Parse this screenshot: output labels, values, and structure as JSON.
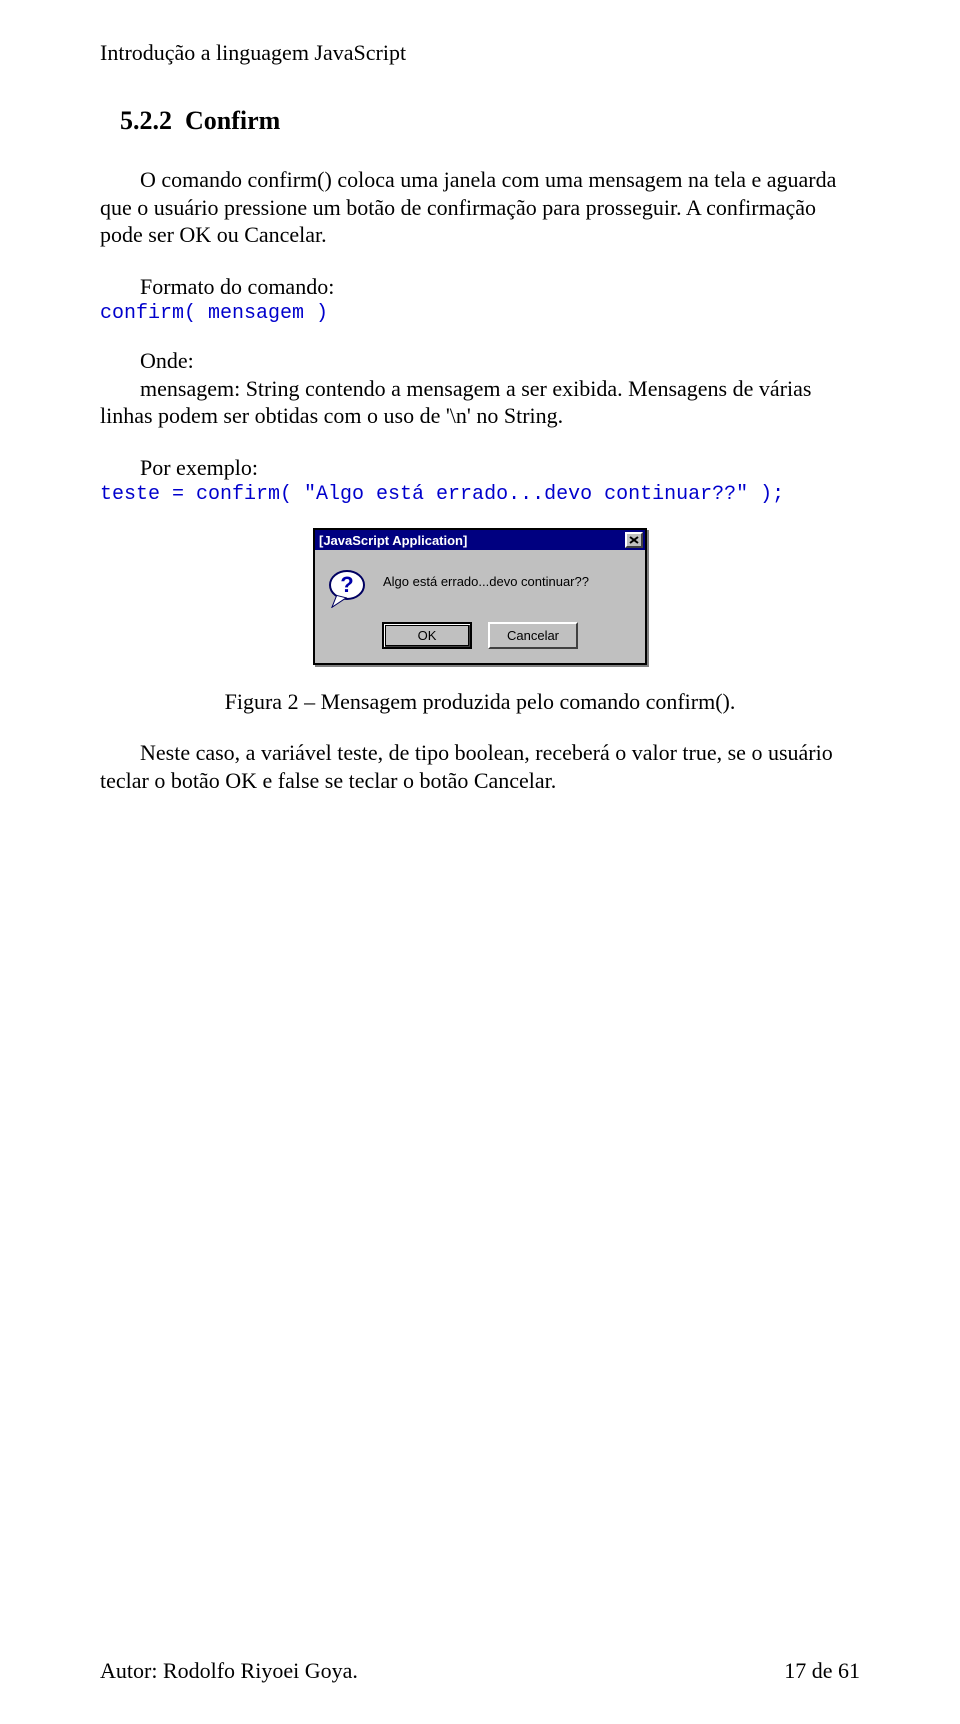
{
  "header": "Introdução a linguagem JavaScript",
  "section": {
    "number": "5.2.2",
    "title": "Confirm"
  },
  "p1": "O comando confirm() coloca uma janela com uma mensagem na tela e aguarda que o usuário pressione um botão de confirmação para prosseguir. A confirmação pode ser OK ou Cancelar.",
  "format_label": "Formato do comando:",
  "format_code": "confirm( mensagem )",
  "onde_label": "Onde:",
  "onde_desc": "mensagem: String contendo a mensagem a ser exibida. Mensagens de várias linhas podem ser obtidas com o uso de '\\n' no String.",
  "ex_label": "Por exemplo:",
  "ex_code": "teste = confirm( \"Algo está errado...devo continuar??\" );",
  "dialog": {
    "title": "[JavaScript Application]",
    "message": "Algo está errado...devo continuar??",
    "ok": "OK",
    "cancel": "Cancelar"
  },
  "fig_caption": "Figura 2 – Mensagem produzida pelo comando confirm().",
  "p_after": "Neste caso, a variável teste, de tipo boolean, receberá o valor true, se o usuário teclar o botão OK e false se teclar o botão Cancelar.",
  "footer_author": "Autor: Rodolfo Riyoei Goya.",
  "footer_page": "17 de 61"
}
